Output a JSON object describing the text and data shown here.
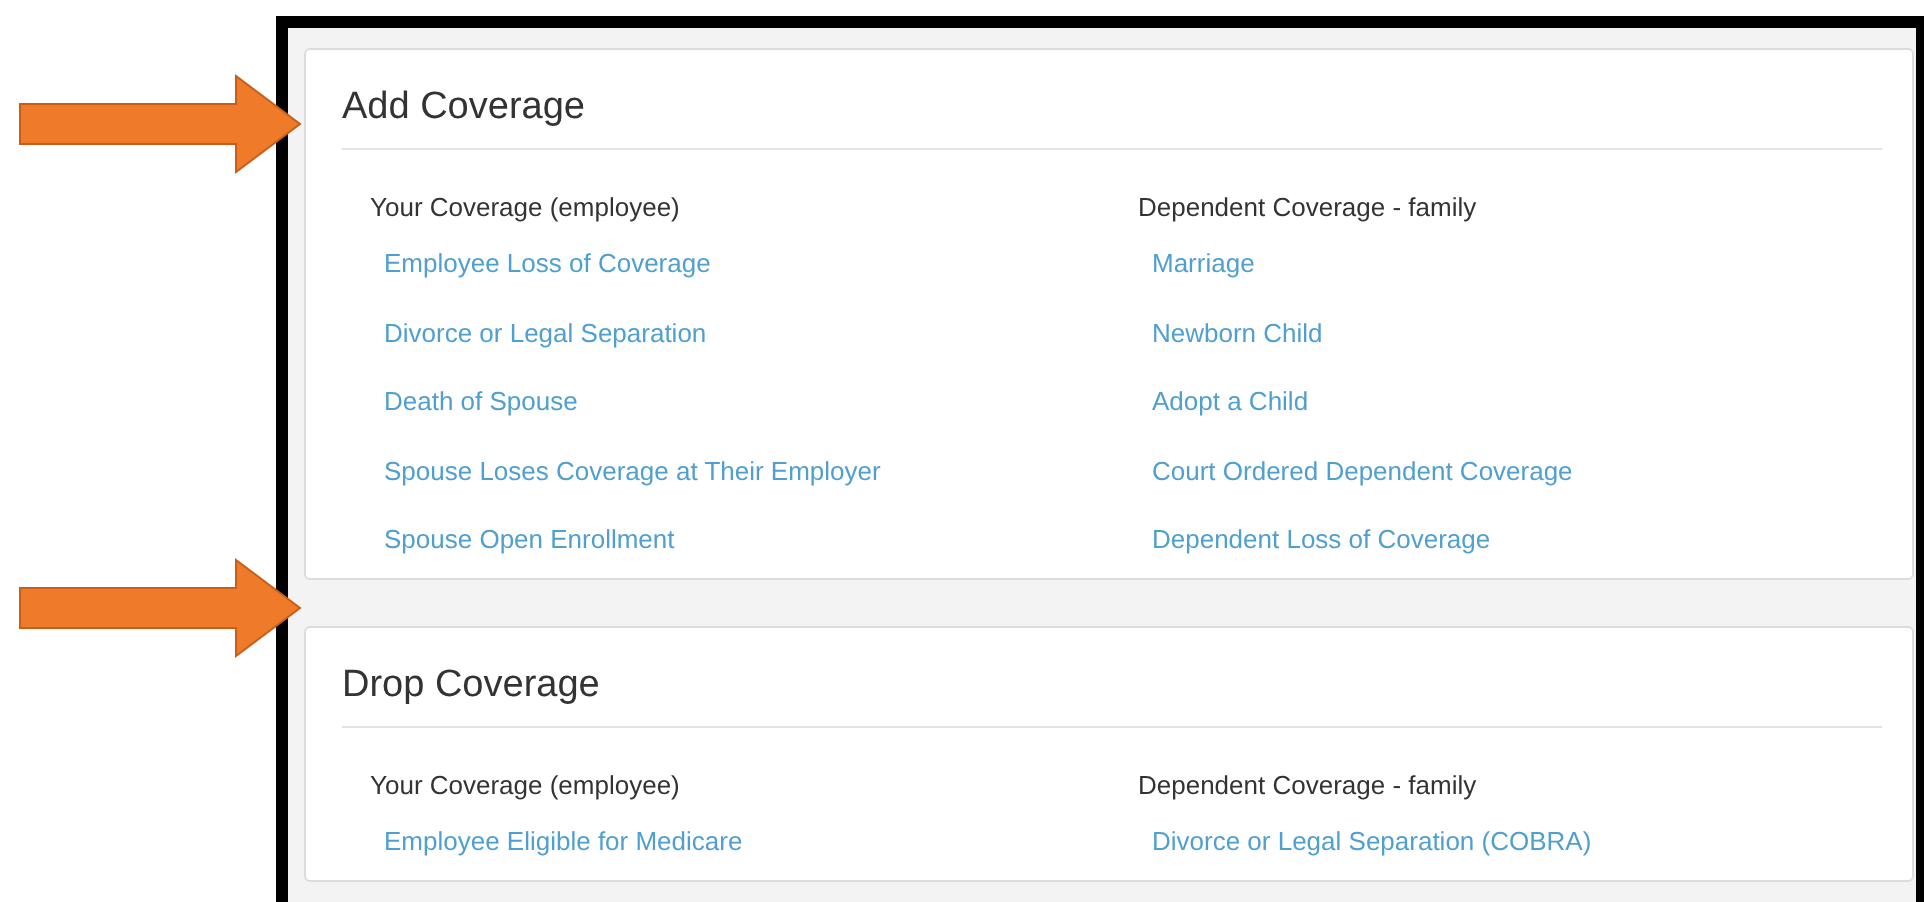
{
  "sections": [
    {
      "title": "Add Coverage",
      "columns": [
        {
          "heading": "Your Coverage (employee)",
          "links": [
            "Employee Loss of Coverage",
            "Divorce or Legal Separation",
            "Death of Spouse",
            "Spouse Loses Coverage at Their Employer",
            "Spouse Open Enrollment"
          ]
        },
        {
          "heading": "Dependent Coverage - family",
          "links": [
            "Marriage",
            "Newborn Child",
            "Adopt a Child",
            "Court Ordered Dependent Coverage",
            "Dependent Loss of Coverage"
          ]
        }
      ]
    },
    {
      "title": "Drop Coverage",
      "columns": [
        {
          "heading": "Your Coverage (employee)",
          "links": [
            "Employee Eligible for Medicare"
          ]
        },
        {
          "heading": "Dependent Coverage - family",
          "links": [
            "Divorce or Legal Separation (COBRA)"
          ]
        }
      ]
    }
  ]
}
